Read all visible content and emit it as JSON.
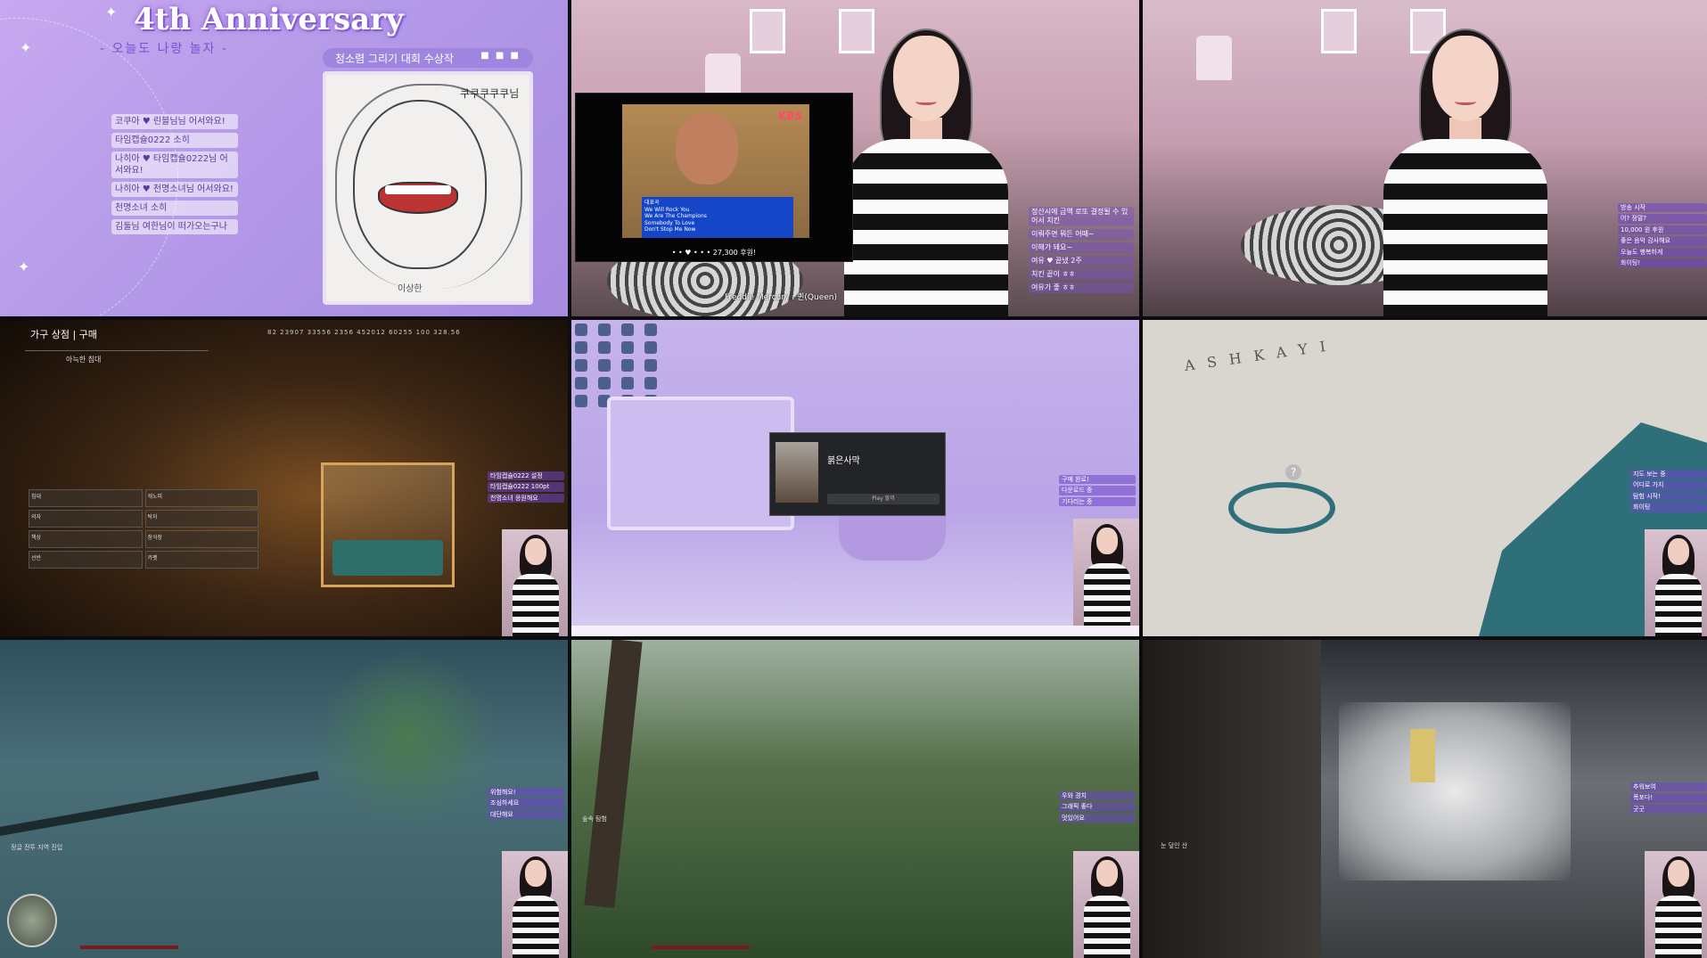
{
  "tile1": {
    "title": "4th Anniversary",
    "subtitle": "- 오늘도 나랑 놀자 -",
    "contest_label": "청소렴 그리기 대회 수상작",
    "contest_dots": "■ ■ ■",
    "sketch_signature": "쿠쿠쿠쿠쿠님",
    "sketch_bottom": "이상한",
    "chat": [
      "코쿠아 ♥ 린블님님 어서와요!",
      "타임캡슐0222 소히",
      "나히아 ♥ 타임캡슐0222님 어서와요!",
      "나히아 ♥ 천명소녀님 어서와요!",
      "천명소녀 소히",
      "김둘님 여한님이 떠가오는구나"
    ]
  },
  "tile2": {
    "tv_logo": "KBS",
    "tv_caption": "대표곡\nWe Will Rock You\nWe Are The Champions\nSomebody To Love\nDon't Stop Me Now",
    "tv_bottom": "• • ♥ • • • 27,300 후원!",
    "credit": "Freddie Mercury : 퀸(Queen)",
    "chat": [
      "정산시에 금액 로또 결정될 수 있어서 치킨",
      "이뤄주면 뭐든 어때~",
      "이해가 돼요~",
      "여유 ♥ 끝냈 2주",
      "치킨 끝이 ㅎㅎ",
      "여유가 좋 ㅎㅎ"
    ]
  },
  "tile3": {
    "chat": [
      "방송 시작",
      "어? 정말?",
      "10,000 원 후원",
      "좋은 음악 감사해요",
      "오늘도 행복하게",
      "화이팅!"
    ]
  },
  "tile4": {
    "shop_title": "가구 상점 | 구매",
    "shop_top": "82   23907   33556   2356   452012   60255   100   328.56",
    "item_header": "아늑한 침대",
    "items": [
      "침대",
      "캐노피",
      "의자",
      "탁자",
      "책상",
      "장식장",
      "선반",
      "카펫"
    ],
    "chat": [
      "타임캡슐0222 설정",
      "타임캡슐0222 100pt",
      "천명소녀 응원해요"
    ]
  },
  "tile5": {
    "dialog_name": "붉은사막",
    "dialog_btn": "Play 할까",
    "chat": [
      "구매 완료!",
      "다운로드 중",
      "기다리는 중"
    ]
  },
  "tile6": {
    "map_title": "ASHKAYI",
    "question": "?",
    "chat": [
      "지도 보는 중",
      "어디로 가지",
      "탐험 시작!",
      "화이팅"
    ]
  },
  "tile7": {
    "hud": "정글 전투 지역 진입",
    "chat": [
      "위험해요!",
      "조심하세요",
      "대단해요"
    ]
  },
  "tile8": {
    "hud": "숲속 탐험",
    "chat": [
      "우와 경치",
      "그래픽 좋다",
      "멋있어요"
    ]
  },
  "tile9": {
    "hud": "눈 덮인 산",
    "chat": [
      "추워보여",
      "폭포다!",
      "굿굿"
    ]
  }
}
